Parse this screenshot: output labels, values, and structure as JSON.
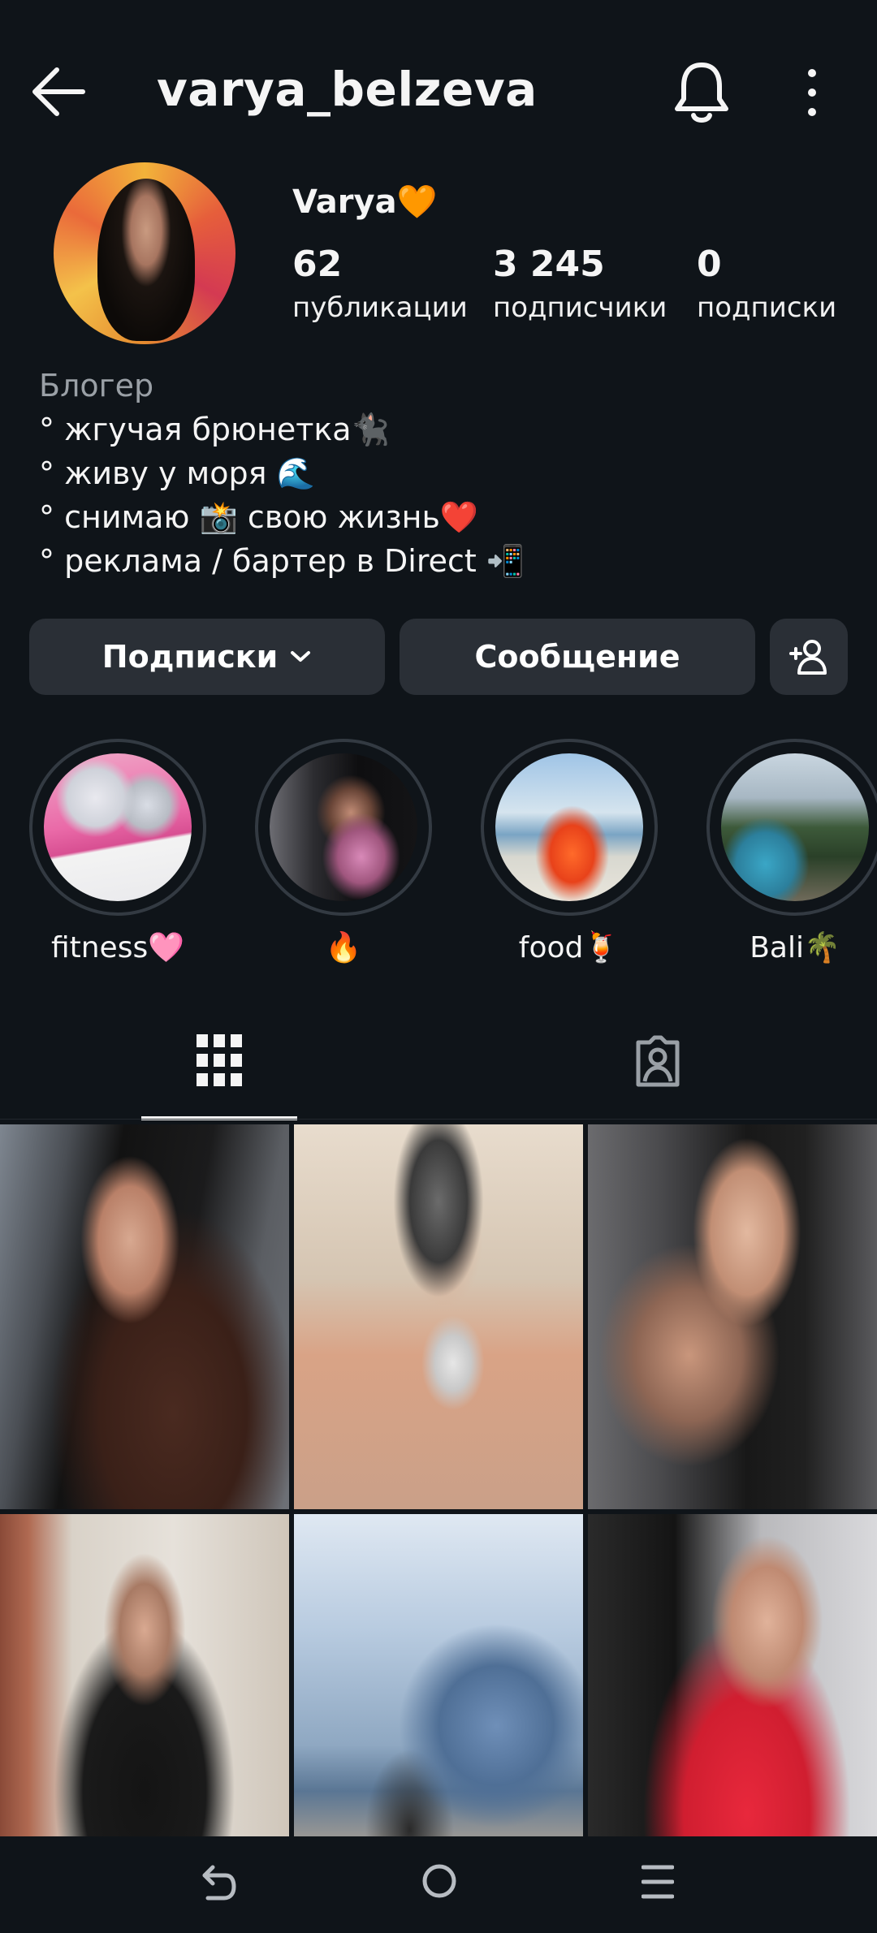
{
  "header": {
    "username": "varya_belzeva",
    "back_icon": "arrow-left-icon",
    "bell_icon": "bell-icon",
    "more_icon": "more-vertical-icon"
  },
  "profile": {
    "display_name": "Varya🧡",
    "stats": [
      {
        "value": "62",
        "label": "публикации"
      },
      {
        "value": "3 245",
        "label": "подписчики"
      },
      {
        "value": "0",
        "label": "подписки"
      }
    ],
    "category": "Блогер",
    "bio_lines": [
      "° жгучая брюнетка🐈‍⬛",
      "° живу у моря 🌊",
      "° снимаю 📸 свою жизнь❤️",
      "° реклама / бартер в Direct 📲"
    ]
  },
  "actions": {
    "follow_label": "Подписки",
    "message_label": "Сообщение",
    "add_user_icon": "add-user-icon"
  },
  "highlights": [
    {
      "label": "fitness🩷"
    },
    {
      "label": "🔥"
    },
    {
      "label": "food🍹"
    },
    {
      "label": "Bali🌴"
    }
  ],
  "tabs": {
    "grid_icon": "grid-icon",
    "tagged_icon": "tagged-icon",
    "active": "grid"
  },
  "colors": {
    "background": "#0f1419",
    "button": "#2a2f36",
    "text": "#f5f5f5",
    "muted": "#9aa0a6"
  },
  "navbar": {
    "back_icon": "nav-back-icon",
    "home_icon": "nav-home-icon",
    "recent_icon": "nav-recent-icon"
  }
}
